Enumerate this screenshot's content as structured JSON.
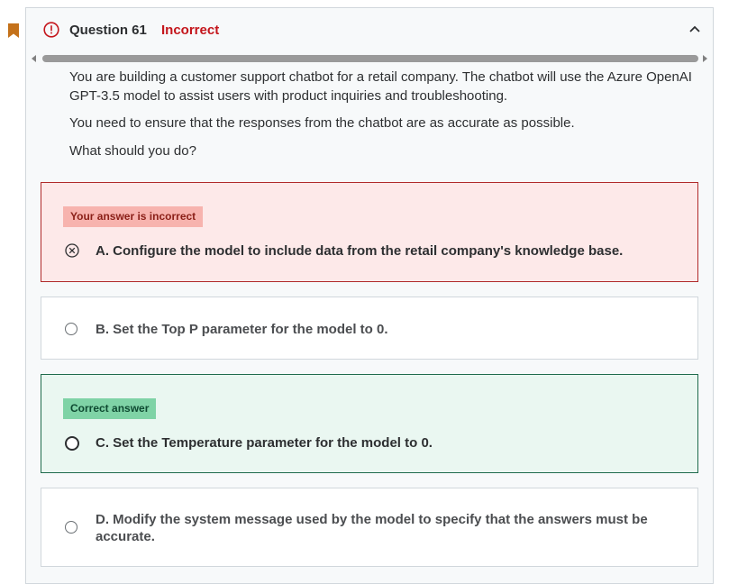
{
  "question": {
    "title": "Question 61",
    "status": "Incorrect"
  },
  "prompt": {
    "p1": "You are building a customer support chatbot for a retail company. The chatbot will use the Azure OpenAI GPT-3.5 model to assist users with product inquiries and troubleshooting.",
    "p2": "You need to ensure that the responses from the chatbot are as accurate as possible.",
    "p3": "What should you do?"
  },
  "options": [
    {
      "tag": "Your answer is incorrect",
      "text": "A. Configure the model to include data from the retail company's knowledge base."
    },
    {
      "text": "B. Set the Top P parameter for the model to 0."
    },
    {
      "tag": "Correct answer",
      "text": "C. Set the Temperature parameter for the model to 0."
    },
    {
      "text": "D. Modify the system message used by the model to specify that the answers must be accurate."
    }
  ],
  "colors": {
    "incorrect": "#c4161c",
    "wrong_bg": "#fde9e9",
    "correct_bg": "#eaf7f1",
    "bookmark": "#c4711a"
  },
  "icons": {
    "status": "exclamation-circle-icon",
    "collapse": "chevron-up-icon",
    "wrong_mark": "x-circle-icon",
    "bookmark": "bookmark-icon"
  }
}
